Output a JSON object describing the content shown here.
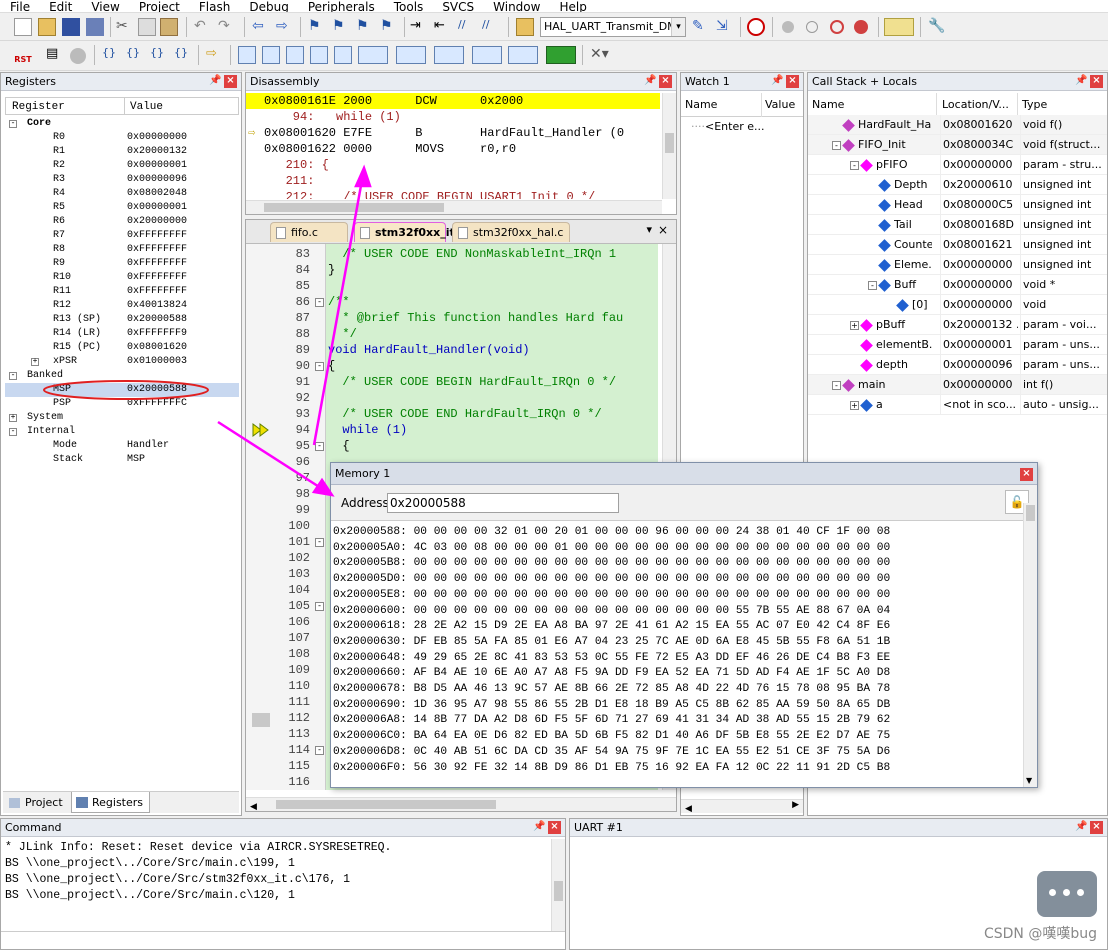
{
  "menu": [
    "File",
    "Edit",
    "View",
    "Project",
    "Flash",
    "Debug",
    "Peripherals",
    "Tools",
    "SVCS",
    "Window",
    "Help"
  ],
  "toolbar": {
    "target_name": "HAL_UART_Transmit_DMA",
    "rst_label": "RST"
  },
  "registers": {
    "title": "Registers",
    "col_register": "Register",
    "col_value": "Value",
    "rows": [
      {
        "name": "Core",
        "value": "",
        "indent": 0,
        "bold": true,
        "exp": "-"
      },
      {
        "name": "R0",
        "value": "0x00000000",
        "indent": 2
      },
      {
        "name": "R1",
        "value": "0x20000132",
        "indent": 2
      },
      {
        "name": "R2",
        "value": "0x00000001",
        "indent": 2
      },
      {
        "name": "R3",
        "value": "0x00000096",
        "indent": 2
      },
      {
        "name": "R4",
        "value": "0x08002048",
        "indent": 2
      },
      {
        "name": "R5",
        "value": "0x00000001",
        "indent": 2
      },
      {
        "name": "R6",
        "value": "0x20000000",
        "indent": 2
      },
      {
        "name": "R7",
        "value": "0xFFFFFFFF",
        "indent": 2
      },
      {
        "name": "R8",
        "value": "0xFFFFFFFF",
        "indent": 2
      },
      {
        "name": "R9",
        "value": "0xFFFFFFFF",
        "indent": 2
      },
      {
        "name": "R10",
        "value": "0xFFFFFFFF",
        "indent": 2
      },
      {
        "name": "R11",
        "value": "0xFFFFFFFF",
        "indent": 2
      },
      {
        "name": "R12",
        "value": "0x40013824",
        "indent": 2
      },
      {
        "name": "R13 (SP)",
        "value": "0x20000588",
        "indent": 2
      },
      {
        "name": "R14 (LR)",
        "value": "0xFFFFFFF9",
        "indent": 2
      },
      {
        "name": "R15 (PC)",
        "value": "0x08001620",
        "indent": 2
      },
      {
        "name": "xPSR",
        "value": "0x01000003",
        "indent": 2,
        "exp": "+"
      },
      {
        "name": "Banked",
        "value": "",
        "indent": 0,
        "exp": "-"
      },
      {
        "name": "MSP",
        "value": "0x20000588",
        "indent": 2,
        "sel": true
      },
      {
        "name": "PSP",
        "value": "0xFFFFFFFC",
        "indent": 2
      },
      {
        "name": "System",
        "value": "",
        "indent": 0,
        "exp": "+"
      },
      {
        "name": "Internal",
        "value": "",
        "indent": 0,
        "exp": "-"
      },
      {
        "name": "Mode",
        "value": "Handler",
        "indent": 2
      },
      {
        "name": "Stack",
        "value": "MSP",
        "indent": 2
      }
    ],
    "tab_project": "Project",
    "tab_registers": "Registers"
  },
  "disassembly": {
    "title": "Disassembly",
    "lines": [
      {
        "text": "0x0800161E 2000      DCW      0x2000",
        "hl": true
      },
      {
        "text": "    94:   while (1)",
        "src": true
      },
      {
        "text": "0x08001620 E7FE      B        HardFault_Handler (0",
        "arrow": true
      },
      {
        "text": "0x08001622 0000      MOVS     r0,r0"
      },
      {
        "text": "   210: {",
        "src": true
      },
      {
        "text": "   211:",
        "src": true
      },
      {
        "text": "   212:    /* USER CODE BEGIN USART1_Init 0 */",
        "src": true
      }
    ]
  },
  "editor": {
    "tabs": [
      "fifo.c",
      "stm32f0xx_it.c",
      "stm32f0xx_hal.c"
    ],
    "lines": [
      {
        "n": "83",
        "t": "  /* USER CODE END NonMaskableInt_IRQn 1",
        "c": true
      },
      {
        "n": "84",
        "t": "}"
      },
      {
        "n": "85",
        "t": ""
      },
      {
        "n": "86",
        "t": "/**",
        "c": true,
        "fold": true
      },
      {
        "n": "87",
        "t": "  * @brief This function handles Hard fau",
        "c": true
      },
      {
        "n": "88",
        "t": "  */",
        "c": true
      },
      {
        "n": "89",
        "t": "void HardFault_Handler(void)",
        "fn": true
      },
      {
        "n": "90",
        "t": "{",
        "fold": true
      },
      {
        "n": "91",
        "t": "  /* USER CODE BEGIN HardFault_IRQn 0 */",
        "c": true
      },
      {
        "n": "92",
        "t": ""
      },
      {
        "n": "93",
        "t": "  /* USER CODE END HardFault_IRQn 0 */",
        "c": true
      },
      {
        "n": "94",
        "t": "  while (1)",
        "kw": true
      },
      {
        "n": "95",
        "t": "  {",
        "fold": true
      },
      {
        "n": "96",
        "t": ""
      },
      {
        "n": "97",
        "t": ""
      },
      {
        "n": "98",
        "t": ""
      },
      {
        "n": "99",
        "t": ""
      },
      {
        "n": "100",
        "t": ""
      },
      {
        "n": "101",
        "t": "",
        "fold": true
      },
      {
        "n": "102",
        "t": ""
      },
      {
        "n": "103",
        "t": ""
      },
      {
        "n": "104",
        "t": ""
      },
      {
        "n": "105",
        "t": "",
        "fold": true
      },
      {
        "n": "106",
        "t": ""
      },
      {
        "n": "107",
        "t": ""
      },
      {
        "n": "108",
        "t": ""
      },
      {
        "n": "109",
        "t": ""
      },
      {
        "n": "110",
        "t": ""
      },
      {
        "n": "111",
        "t": ""
      },
      {
        "n": "112",
        "t": ""
      },
      {
        "n": "113",
        "t": ""
      },
      {
        "n": "114",
        "t": "",
        "fold": true
      },
      {
        "n": "115",
        "t": ""
      },
      {
        "n": "116",
        "t": ""
      }
    ]
  },
  "watch": {
    "title": "Watch 1",
    "col_name": "Name",
    "col_value": "Value",
    "enter": "<Enter e..."
  },
  "callstack": {
    "title": "Call Stack + Locals",
    "col_name": "Name",
    "col_loc": "Location/V...",
    "col_type": "Type",
    "rows": [
      {
        "name": "HardFault_Ha...",
        "loc": "0x08001620",
        "type": "void f()",
        "lvl": 0,
        "icon": "fn"
      },
      {
        "name": "FIFO_Init",
        "loc": "0x0800034C",
        "type": "void f(struct...",
        "lvl": 0,
        "icon": "fn",
        "exp": "-"
      },
      {
        "name": "pFIFO",
        "loc": "0x00000000",
        "type": "param - stru...",
        "lvl": 1,
        "icon": "param",
        "exp": "-"
      },
      {
        "name": "Depth",
        "loc": "0x20000610",
        "type": "unsigned int",
        "lvl": 2,
        "icon": "var"
      },
      {
        "name": "Head",
        "loc": "0x080000C5",
        "type": "unsigned int",
        "lvl": 2,
        "icon": "var"
      },
      {
        "name": "Tail",
        "loc": "0x0800168D",
        "type": "unsigned int",
        "lvl": 2,
        "icon": "var"
      },
      {
        "name": "Counter",
        "loc": "0x08001621",
        "type": "unsigned int",
        "lvl": 2,
        "icon": "var"
      },
      {
        "name": "Eleme...",
        "loc": "0x00000000",
        "type": "unsigned int",
        "lvl": 2,
        "icon": "var"
      },
      {
        "name": "Buff",
        "loc": "0x00000000",
        "type": "void *",
        "lvl": 2,
        "icon": "ptr",
        "exp": "-"
      },
      {
        "name": "[0]",
        "loc": "0x00000000",
        "type": "void",
        "lvl": 3,
        "icon": "var"
      },
      {
        "name": "pBuff",
        "loc": "0x20000132 ...",
        "type": "param - voi...",
        "lvl": 1,
        "icon": "param",
        "exp": "+"
      },
      {
        "name": "elementB...",
        "loc": "0x00000001",
        "type": "param - uns...",
        "lvl": 1,
        "icon": "param"
      },
      {
        "name": "depth",
        "loc": "0x00000096",
        "type": "param - uns...",
        "lvl": 1,
        "icon": "param"
      },
      {
        "name": "main",
        "loc": "0x00000000",
        "type": "int f()",
        "lvl": 0,
        "icon": "fn",
        "exp": "-"
      },
      {
        "name": "a",
        "loc": "<not in sco...",
        "type": "auto - unsig...",
        "lvl": 1,
        "icon": "var",
        "exp": "+"
      }
    ]
  },
  "memory": {
    "title": "Memory 1",
    "address_label": "Address:",
    "address_value": "0x20000588",
    "rows": [
      "0x20000588: 00 00 00 00 32 01 00 20 01 00 00 00 96 00 00 00 24 38 01 40 CF 1F 00 08",
      "0x200005A0: 4C 03 00 08 00 00 00 01 00 00 00 00 00 00 00 00 00 00 00 00 00 00 00 00",
      "0x200005B8: 00 00 00 00 00 00 00 00 00 00 00 00 00 00 00 00 00 00 00 00 00 00 00 00",
      "0x200005D0: 00 00 00 00 00 00 00 00 00 00 00 00 00 00 00 00 00 00 00 00 00 00 00 00",
      "0x200005E8: 00 00 00 00 00 00 00 00 00 00 00 00 00 00 00 00 00 00 00 00 00 00 00 00",
      "0x20000600: 00 00 00 00 00 00 00 00 00 00 00 00 00 00 00 00 55 7B 55 AE 88 67 0A 04",
      "0x20000618: 28 2E A2 15 D9 2E EA A8 BA 97 2E 41 61 A2 15 EA 55 AC 07 E0 42 C4 8F E6",
      "0x20000630: DF EB 85 5A FA 85 01 E6 A7 04 23 25 7C AE 0D 6A E8 45 5B 55 F8 6A 51 1B",
      "0x20000648: 49 29 65 2E 8C 41 83 53 53 0C 55 FE 72 E5 A3 DD EF 46 26 DE C4 B8 F3 EE",
      "0x20000660: AF B4 AE 10 6E A0 A7 A8 F5 9A DD F9 EA 52 EA 71 5D AD F4 AE 1F 5C A0 D8",
      "0x20000678: B8 D5 AA 46 13 9C 57 AE 8B 66 2E 72 85 A8 4D 22 4D 76 15 78 08 95 BA 78",
      "0x20000690: 1D 36 95 A7 98 55 86 55 2B D1 E8 18 B9 A5 C5 8B 62 85 AA 59 50 8A 65 DB",
      "0x200006A8: 14 8B 77 DA A2 D8 6D F5 5F 6D 71 27 69 41 31 34 AD 38 AD 55 15 2B 79 62",
      "0x200006C0: BA 64 EA 0E D6 82 ED BA 5D 6B F5 82 D1 40 A6 DF 5B E8 55 2E E2 D7 AE 75",
      "0x200006D8: 0C 40 AB 51 6C DA CD 35 AF 54 9A 75 9F 7E 1C EA 55 E2 51 CE 3F 75 5A D6",
      "0x200006F0: 56 30 92 FE 32 14 8B D9 86 D1 EB 75 16 92 EA FA 12 0C 22 11 91 2D C5 B8"
    ]
  },
  "command": {
    "title": "Command",
    "lines": [
      "* JLink Info: Reset: Reset device via AIRCR.SYSRESETREQ.",
      "BS \\\\one_project\\../Core/Src/main.c\\199, 1",
      "BS \\\\one_project\\../Core/Src/stm32f0xx_it.c\\176, 1",
      "BS \\\\one_project\\../Core/Src/main.c\\120, 1"
    ]
  },
  "uart": {
    "title": "UART #1"
  },
  "watermark": "CSDN @嘆嘆bug",
  "colors": {
    "accent": "#ff00ff",
    "highlight": "#ffff00",
    "code_bg": "#d4f0d0",
    "comment": "#008000",
    "keyword": "#0000ff"
  }
}
